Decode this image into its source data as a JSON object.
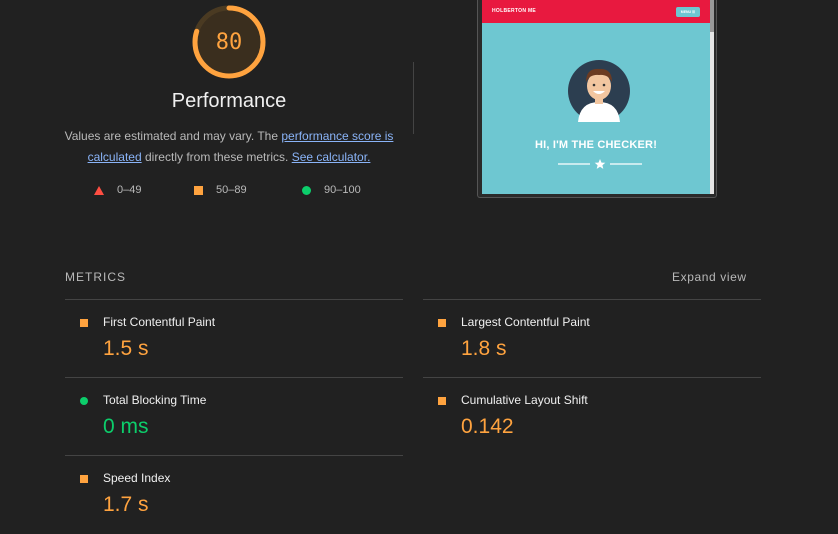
{
  "summary": {
    "score": "80",
    "score_fraction": 0.8,
    "title": "Performance",
    "desc_prefix": "Values are estimated and may vary. The ",
    "desc_link1": "performance score is calculated",
    "desc_middle": " directly from these metrics. ",
    "desc_link2": "See calculator.",
    "legend": [
      {
        "shape": "triangle",
        "range": "0–49",
        "color": "#ff4e42"
      },
      {
        "shape": "square",
        "range": "50–89",
        "color": "#ffa33f"
      },
      {
        "shape": "circle",
        "range": "90–100",
        "color": "#0cce6b"
      }
    ]
  },
  "screenshot": {
    "brand": "HOLBERTON ME",
    "nav_button": "MENU ☰",
    "hero": "HI, I'M THE CHECKER!"
  },
  "metrics": {
    "header": "METRICS",
    "expand": "Expand view",
    "items": [
      {
        "name": "First Contentful Paint",
        "value": "1.5 s",
        "status": "average"
      },
      {
        "name": "Largest Contentful Paint",
        "value": "1.8 s",
        "status": "average"
      },
      {
        "name": "Total Blocking Time",
        "value": "0 ms",
        "status": "pass"
      },
      {
        "name": "Cumulative Layout Shift",
        "value": "0.142",
        "status": "average"
      },
      {
        "name": "Speed Index",
        "value": "1.7 s",
        "status": "average"
      }
    ]
  },
  "colors": {
    "average": "#ffa33f",
    "pass": "#0cce6b",
    "fail": "#ff4e42",
    "background": "#212121"
  }
}
